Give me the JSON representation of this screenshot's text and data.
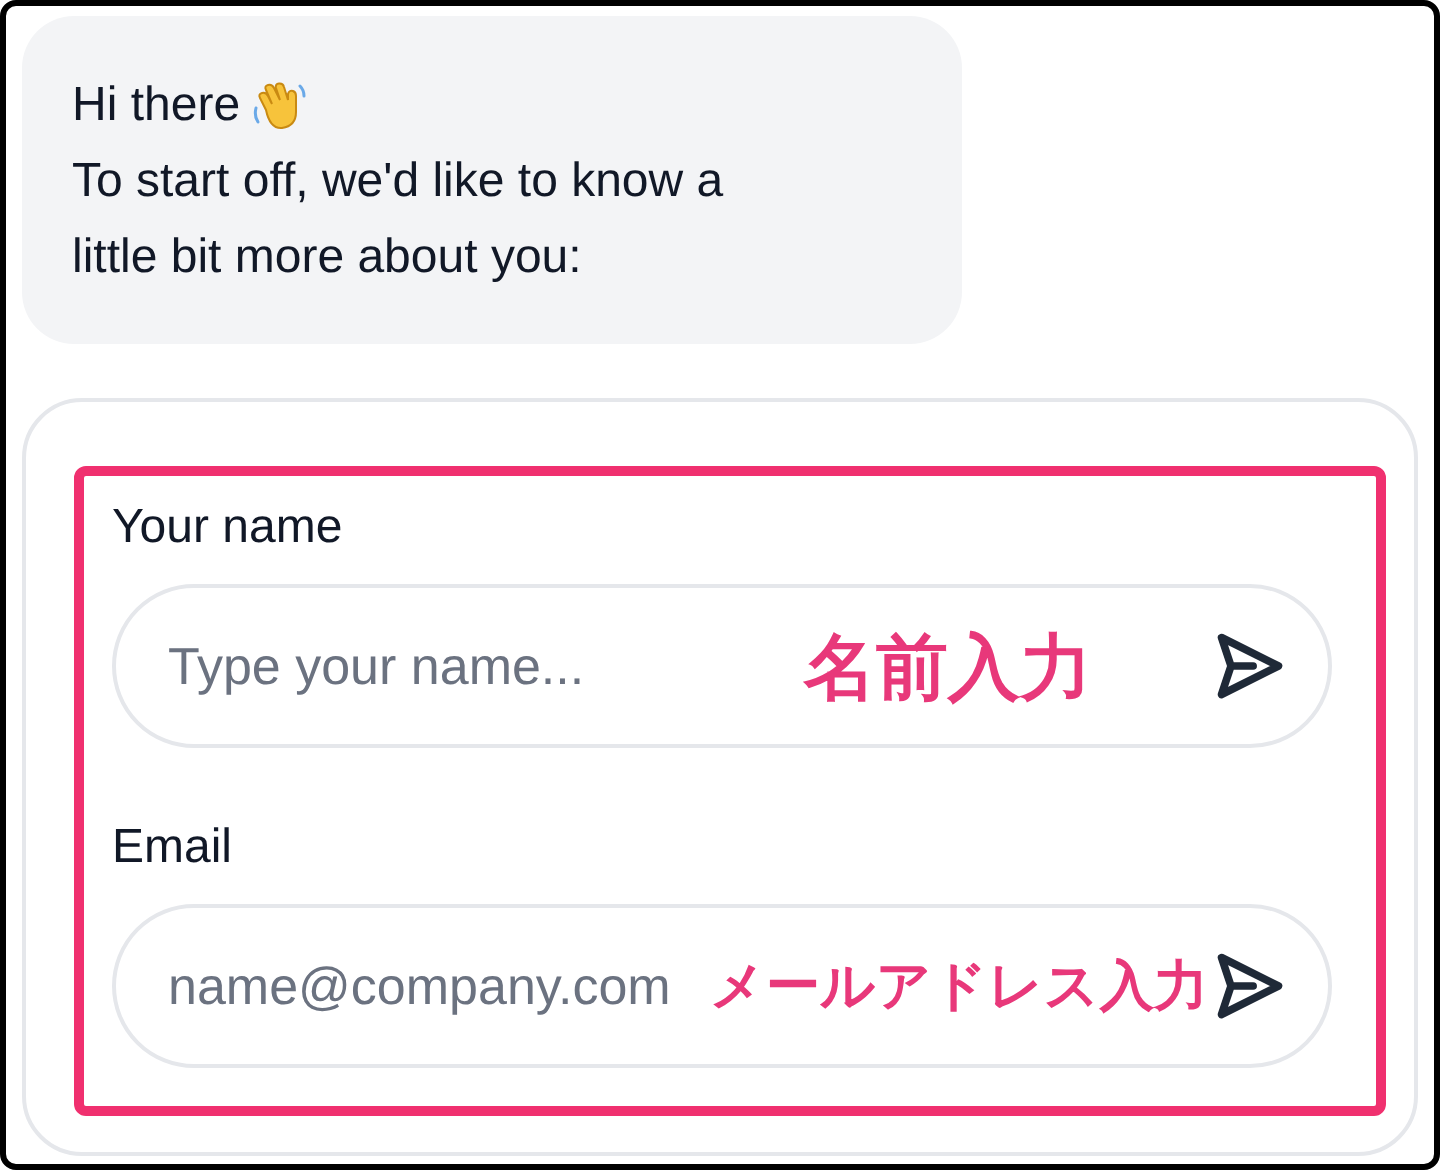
{
  "message": {
    "lines": [
      "Hi there",
      "To start off, we'd like to know a",
      "little bit more about you:"
    ]
  },
  "form": {
    "fields": [
      {
        "label": "Your name",
        "placeholder": "Type your name...",
        "annotation": "名前入力"
      },
      {
        "label": "Email",
        "placeholder": "name@company.com",
        "annotation": "メールアドレス入力"
      }
    ]
  }
}
